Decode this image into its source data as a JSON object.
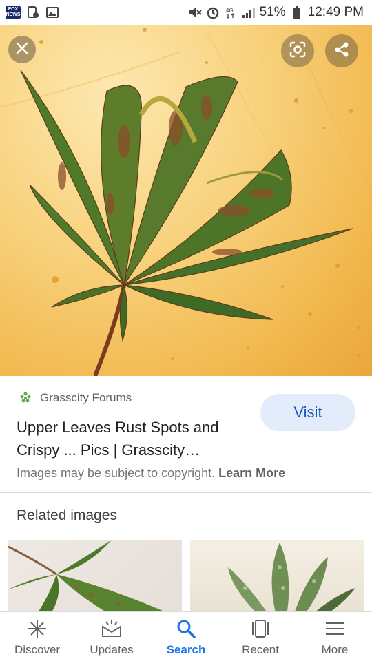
{
  "status_bar": {
    "fox_top": "FOX",
    "fox_bottom": "NEWS",
    "battery": "51%",
    "time": "12:49 PM"
  },
  "result": {
    "source": "Grasscity Forums",
    "title": "Upper Leaves Rust Spots and Crispy ... Pics | Grasscity…",
    "visit_label": "Visit",
    "copyright": "Images may be subject to copyright.",
    "learn_more": "Learn More"
  },
  "related": {
    "heading": "Related images"
  },
  "bottom_nav": [
    {
      "label": "Discover",
      "icon": "asterisk-icon"
    },
    {
      "label": "Updates",
      "icon": "updates-icon"
    },
    {
      "label": "Search",
      "icon": "search-icon",
      "active": true
    },
    {
      "label": "Recent",
      "icon": "recent-icon"
    },
    {
      "label": "More",
      "icon": "menu-icon"
    }
  ],
  "colors": {
    "accent": "#1a73e8",
    "visit_bg": "#e3ecfa",
    "visit_text": "#1a56c4"
  }
}
